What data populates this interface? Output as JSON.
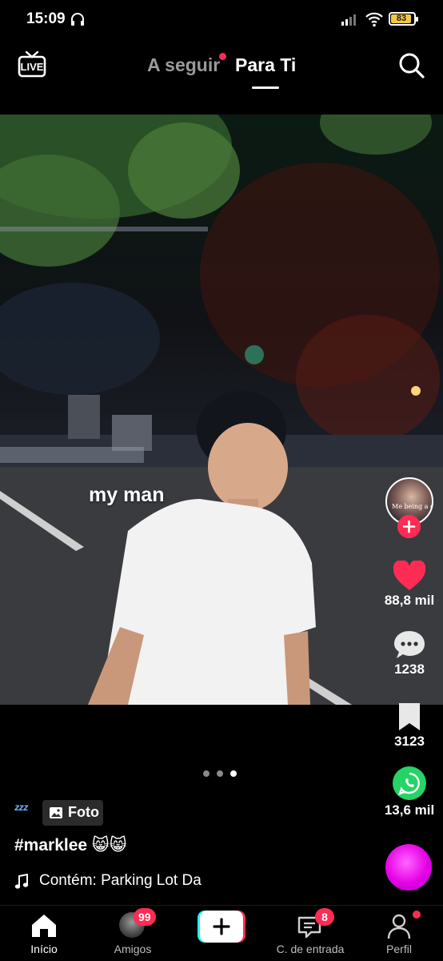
{
  "status_bar": {
    "time": "15:09",
    "battery": "83"
  },
  "top_bar": {
    "live_label": "LIVE",
    "tabs": [
      {
        "label": "A seguir",
        "has_dot": true
      },
      {
        "label": "Para Ti",
        "active": true
      }
    ]
  },
  "post": {
    "overlay_caption": "my man",
    "carousel": {
      "count": 3,
      "active_index": 2
    },
    "author_avatar_text": "Me being a girl",
    "likes": "88,8 mil",
    "comments": "1238",
    "saves": "3123",
    "shares": "13,6 mil",
    "type_badge": "Foto",
    "sleep_emoji_text": "ᶻᶻᶻ",
    "caption": "#marklee 😸😸",
    "music": "Contém: Parking Lot Da"
  },
  "bottom_nav": {
    "items": [
      {
        "label": "Início",
        "active": true
      },
      {
        "label": "Amigos",
        "badge": "99"
      },
      {
        "label": ""
      },
      {
        "label": "C. de entrada",
        "badge": "8"
      },
      {
        "label": "Perfil",
        "has_dot": true
      }
    ]
  },
  "colors": {
    "accent": "#fe2c55",
    "like": "#fe2c55",
    "whatsapp": "#25d366",
    "battery": "#f2c744"
  }
}
